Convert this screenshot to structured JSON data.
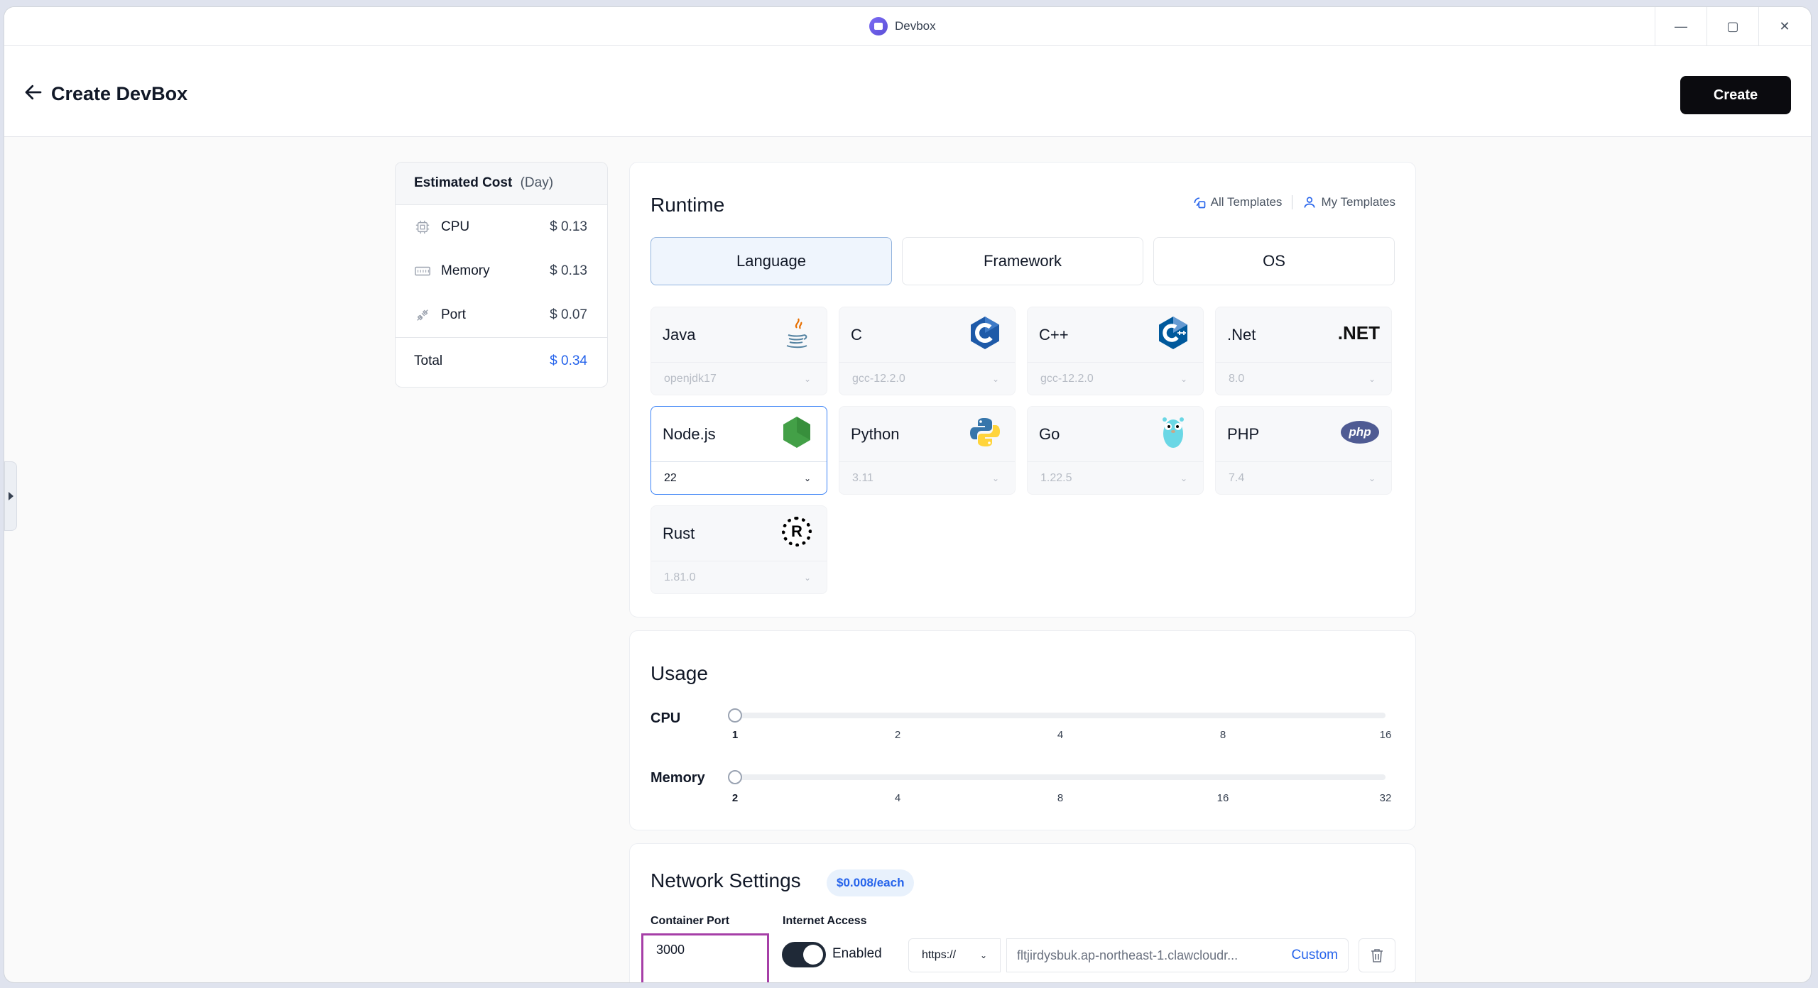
{
  "window": {
    "app_name": "Devbox",
    "minimize": "—",
    "maximize": "▢",
    "close": "✕"
  },
  "header": {
    "title": "Create DevBox",
    "create_label": "Create"
  },
  "cost": {
    "title": "Estimated Cost",
    "period": "(Day)",
    "rows": [
      {
        "label": "CPU",
        "value": "$ 0.13",
        "icon": "cpu-icon"
      },
      {
        "label": "Memory",
        "value": "$ 0.13",
        "icon": "memory-icon"
      },
      {
        "label": "Port",
        "value": "$ 0.07",
        "icon": "port-icon"
      }
    ],
    "total_label": "Total",
    "total_value": "$ 0.34"
  },
  "runtime": {
    "title": "Runtime",
    "all_templates": "All Templates",
    "my_templates": "My Templates",
    "tabs": [
      "Language",
      "Framework",
      "OS"
    ],
    "active_tab": "Language",
    "languages": [
      {
        "name": "Java",
        "version": "openjdk17",
        "icon": "java-icon"
      },
      {
        "name": "C",
        "version": "gcc-12.2.0",
        "icon": "c-icon"
      },
      {
        "name": "C++",
        "version": "gcc-12.2.0",
        "icon": "cpp-icon"
      },
      {
        "name": ".Net",
        "version": "8.0",
        "icon": "dotnet-icon",
        "logo_text": ".NET"
      },
      {
        "name": "Node.js",
        "version": "22",
        "icon": "nodejs-icon",
        "selected": true
      },
      {
        "name": "Python",
        "version": "3.11",
        "icon": "python-icon"
      },
      {
        "name": "Go",
        "version": "1.22.5",
        "icon": "go-icon"
      },
      {
        "name": "PHP",
        "version": "7.4",
        "icon": "php-icon",
        "logo_text": "php"
      },
      {
        "name": "Rust",
        "version": "1.81.0",
        "icon": "rust-icon",
        "logo_text": "R"
      }
    ]
  },
  "usage": {
    "title": "Usage",
    "cpu": {
      "label": "CPU",
      "ticks": [
        "1",
        "2",
        "4",
        "8",
        "16"
      ],
      "selected": "1"
    },
    "memory": {
      "label": "Memory",
      "ticks": [
        "2",
        "4",
        "8",
        "16",
        "32"
      ],
      "selected": "2"
    }
  },
  "network": {
    "title": "Network Settings",
    "price_badge": "$0.008/each",
    "container_port_label": "Container Port",
    "container_port_value": "3000",
    "internet_access_label": "Internet Access",
    "internet_access_status": "Enabled",
    "protocol": "https://",
    "domain": "fltjirdysbuk.ap-northeast-1.clawcloudr...",
    "custom_label": "Custom"
  },
  "colors": {
    "accent": "#2563eb",
    "primary_button": "#0b0b0f",
    "highlight_border": "#a63fa7"
  }
}
